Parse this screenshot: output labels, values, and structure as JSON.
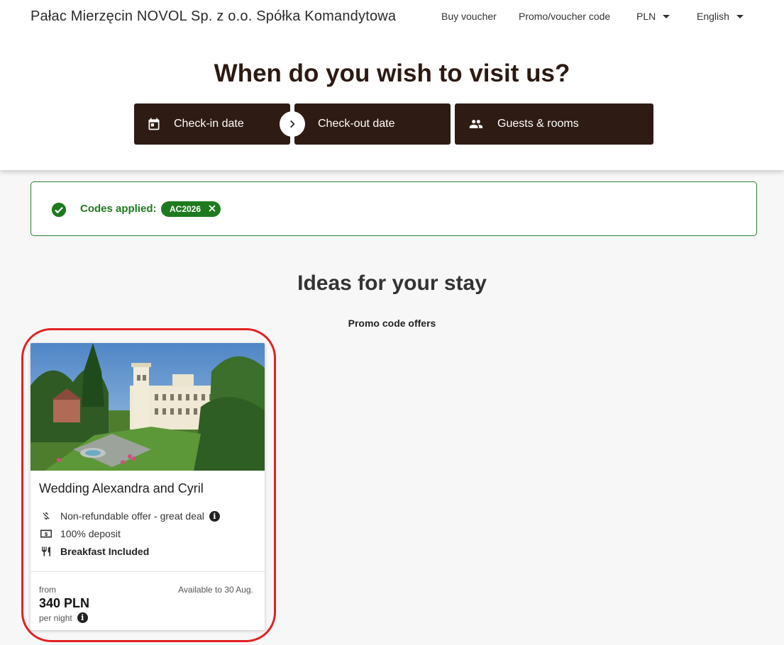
{
  "header": {
    "brand": "Pałac Mierzęcin NOVOL Sp. z o.o. Spółka Komandytowa",
    "nav": {
      "buy_voucher": "Buy voucher",
      "promo_code": "Promo/voucher code",
      "currency": "PLN",
      "language": "English"
    }
  },
  "booking": {
    "headline": "When do you wish to visit us?",
    "check_in": "Check-in date",
    "check_out": "Check-out date",
    "guests": "Guests & rooms",
    "icons": {
      "check_in": "calendar-icon",
      "arrow": "chevron-right-icon",
      "guests": "people-icon"
    }
  },
  "codes": {
    "label": "Codes applied:",
    "chip": "AC2026",
    "status_color": "#1e7a1e"
  },
  "offers": {
    "title": "Ideas for your stay",
    "subtitle": "Promo code offers",
    "cards": [
      {
        "title": "Wedding Alexandra and Cyril",
        "features": [
          {
            "icon": "no-refund-icon",
            "text": "Non-refundable offer - great deal"
          },
          {
            "icon": "cash-icon",
            "text": "100% deposit"
          },
          {
            "icon": "fork-knife-icon",
            "text": "Breakfast Included"
          }
        ],
        "from_label": "from",
        "price": "340 PLN",
        "per_night": "per night",
        "availability": "Available to 30 Aug."
      }
    ]
  },
  "colors": {
    "accent": "#2e1b13",
    "highlight_ring": "#e32222"
  }
}
